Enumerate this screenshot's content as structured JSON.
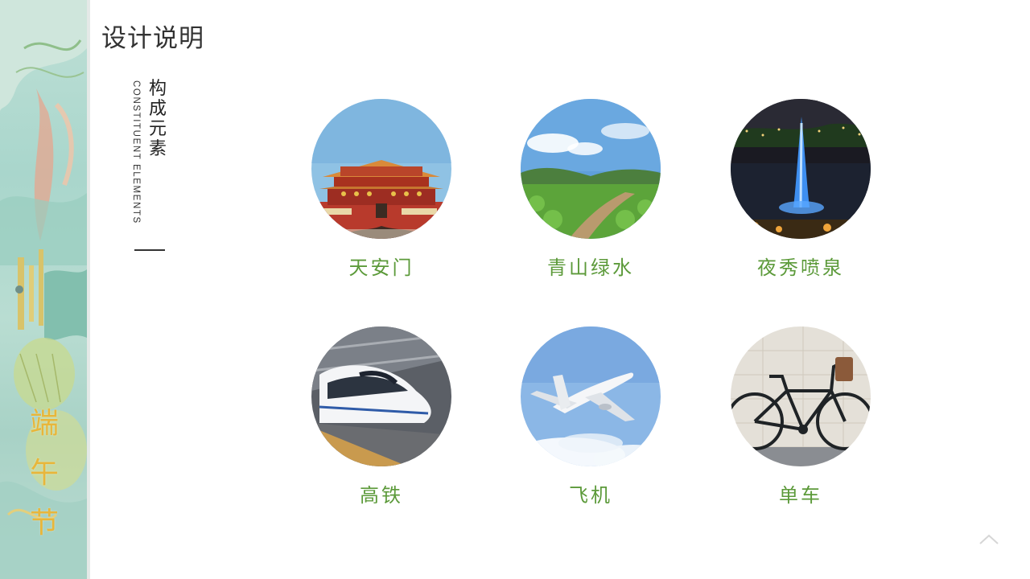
{
  "sidebar": {
    "title_chars": [
      "端",
      "午",
      "节"
    ]
  },
  "header": {
    "title": "设计说明"
  },
  "section": {
    "label_cn": "构成元素",
    "label_en": "CONSTITUENT ELEMENTS"
  },
  "elements": [
    {
      "label": "天安门",
      "icon": "tiananmen-image"
    },
    {
      "label": "青山绿水",
      "icon": "green-hills-image"
    },
    {
      "label": "夜秀喷泉",
      "icon": "night-fountain-image"
    },
    {
      "label": "高铁",
      "icon": "high-speed-train-image"
    },
    {
      "label": "飞机",
      "icon": "airplane-image"
    },
    {
      "label": "单车",
      "icon": "bicycle-image"
    }
  ],
  "colors": {
    "label_green": "#5c9a3a",
    "accent_gold": "#e8b63a",
    "strip_teal": "#a9d6cc"
  }
}
